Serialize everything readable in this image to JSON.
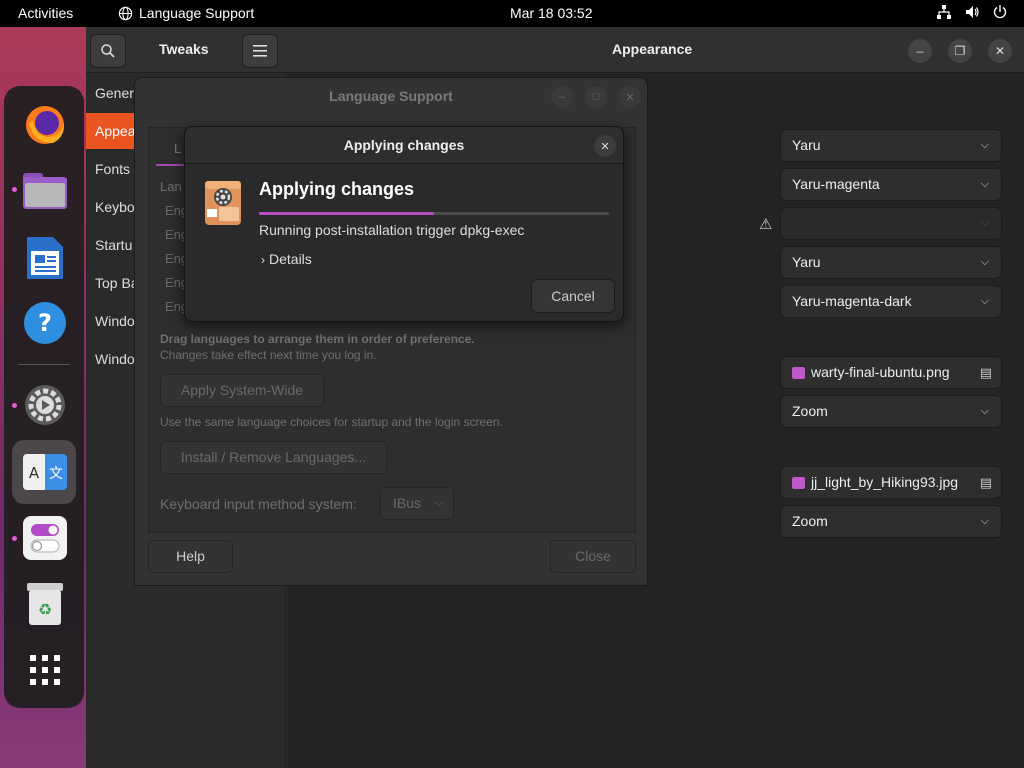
{
  "topbar": {
    "activities": "Activities",
    "app_name": "Language Support",
    "clock": "Mar 18  03:52"
  },
  "dock": {
    "items": [
      "firefox-icon",
      "files-icon",
      "writer-icon",
      "help-icon",
      "settings-icon",
      "language-icon",
      "tweaks-icon",
      "trash-icon",
      "app-grid-icon"
    ]
  },
  "tweaks": {
    "title": "Tweaks",
    "page_title": "Appearance",
    "sidebar": [
      "Gener",
      "Appea",
      "Fonts",
      "Keybo",
      "Startu",
      "Top Ba",
      "Windo",
      "Windo"
    ],
    "combos": {
      "cursor": "Yaru",
      "icons": "Yaru-magenta",
      "shell": "",
      "sound": "Yaru",
      "legacy": "Yaru-magenta-dark",
      "bg_image": "warty-final-ubuntu.png",
      "bg_adjust": "Zoom",
      "lock_image": "jj_light_by_Hiking93.jpg",
      "lock_adjust": "Zoom"
    }
  },
  "language_support": {
    "title": "Language Support",
    "tab": "L",
    "list_label": "Lan",
    "list_items": [
      "Eng",
      "Eng",
      "Eng",
      "Eng",
      "Eng"
    ],
    "drag_text": "Drag languages to arrange them in order of preference.",
    "changes_text": "Changes take effect next time you log in.",
    "apply_btn": "Apply System-Wide",
    "same_text": "Use the same language choices for startup and the login screen.",
    "install_btn": "Install / Remove Languages...",
    "kbd_label": "Keyboard input method system:",
    "kbd_value": "IBus",
    "help_btn": "Help",
    "close_btn": "Close"
  },
  "dialog": {
    "title": "Applying changes",
    "heading": "Applying changes",
    "status": "Running post-installation trigger dpkg-exec",
    "details": "Details",
    "cancel": "Cancel",
    "progress_percent": 50,
    "accent": "#b84ec6"
  }
}
